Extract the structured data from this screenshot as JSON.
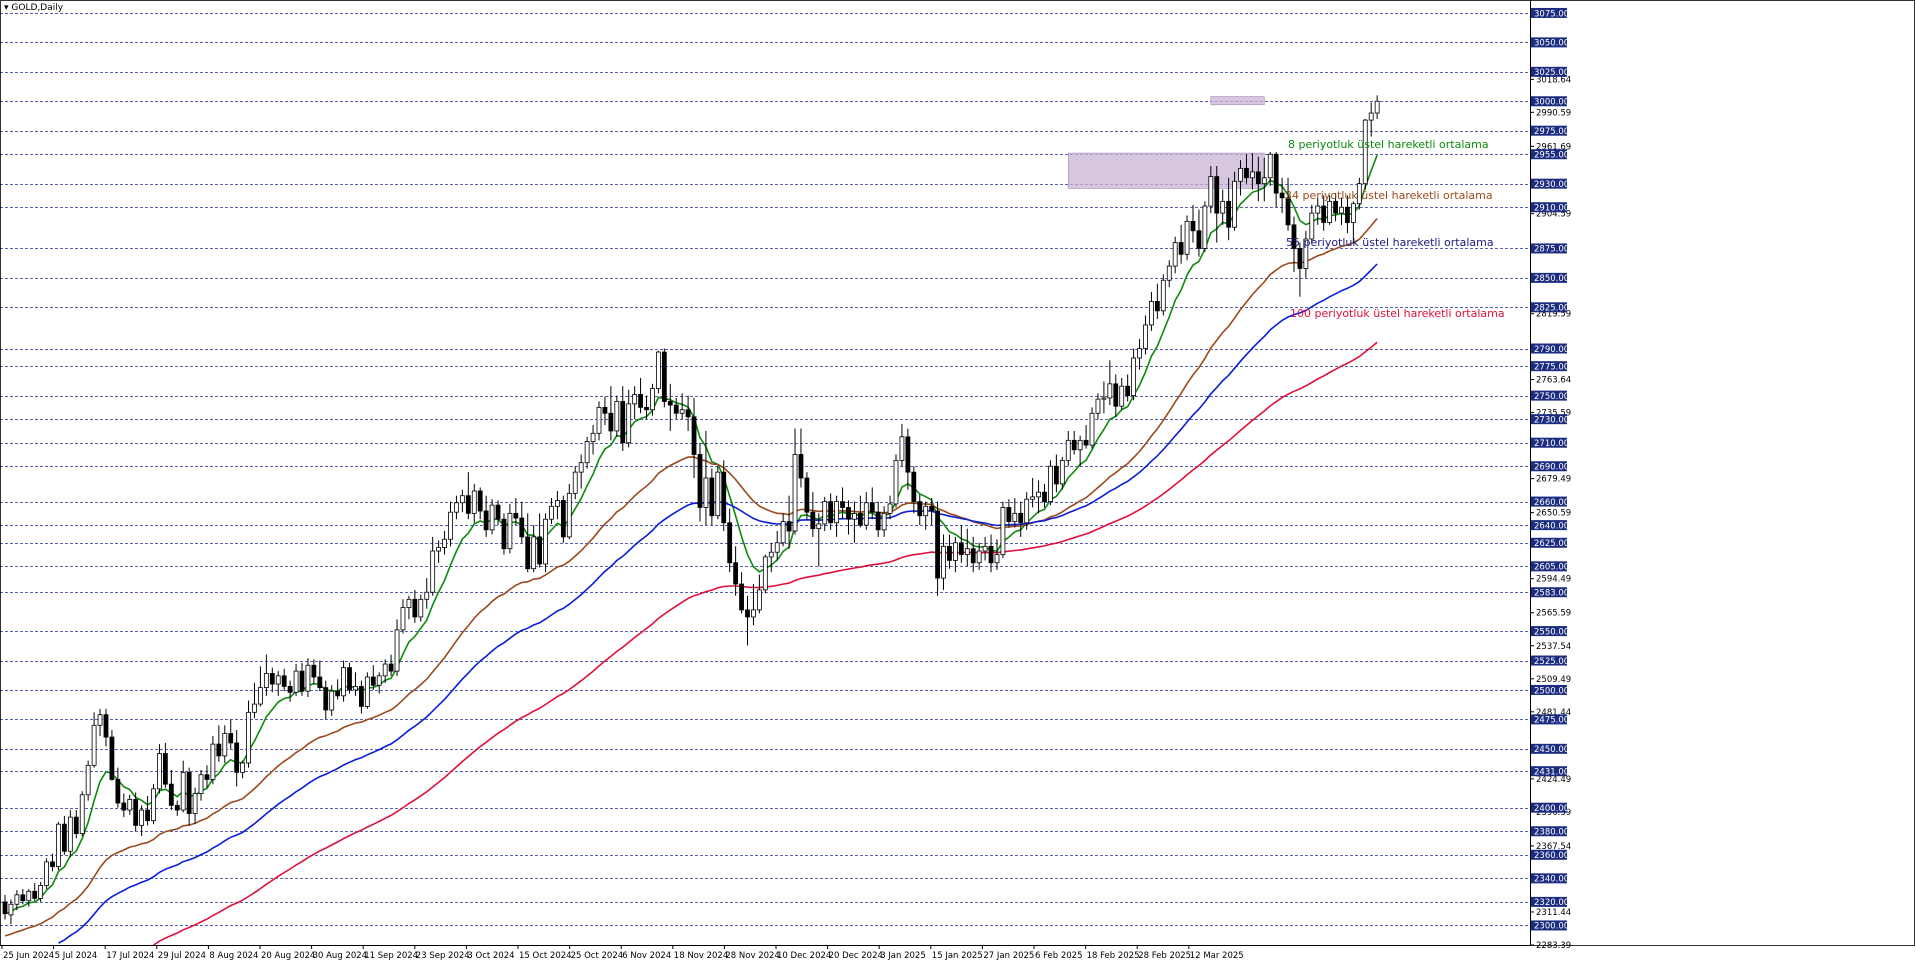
{
  "window": {
    "title": "GOLD,Daily"
  },
  "colors": {
    "background": "#ffffff",
    "grid": "#1f2f8f",
    "candle_up": "#ffffff",
    "candle_down": "#000000",
    "candle_border": "#000000",
    "ema8": "#0b8a0b",
    "ema34": "#9a4a1c",
    "ema55": "#0b1ed6",
    "ema100": "#e0103c",
    "zone": "#c9b3d6",
    "price_box_bg": "#1c2c80",
    "price_box_text": "#ffffff",
    "axis_text": "#000000"
  },
  "annotations": {
    "ema8": "8 periyotluk üstel hareketli ortalama",
    "ema34": "34 periyotluk üstel hareketli ortalama",
    "ema55": "55 periyotluk üstel hareketli ortalama",
    "ema100": "100 periyotluk üstel hareketli ortalama"
  },
  "chart_data": {
    "type": "candlestick",
    "title": "GOLD,Daily",
    "ylim": [
      2283.39,
      3086
    ],
    "x_tick_labels": [
      "25 Jun 2024",
      "5 Jul 2024",
      "17 Jul 2024",
      "29 Jul 2024",
      "8 Aug 2024",
      "20 Aug 2024",
      "30 Aug 2024",
      "11 Sep 2024",
      "23 Sep 2024",
      "3 Oct 2024",
      "15 Oct 2024",
      "25 Oct 2024",
      "6 Nov 2024",
      "18 Nov 2024",
      "28 Nov 2024",
      "10 Dec 2024",
      "20 Dec 2024",
      "3 Jan 2025",
      "15 Jan 2025",
      "27 Jan 2025",
      "6 Feb 2025",
      "18 Feb 2025",
      "28 Feb 2025",
      "12 Mar 2025"
    ],
    "price_levels": [
      3075,
      3050,
      3025,
      3000,
      2975,
      2955,
      2930,
      2910,
      2875,
      2850,
      2825,
      2790,
      2775,
      2750,
      2730,
      2710,
      2690,
      2660,
      2640,
      2625,
      2605,
      2583,
      2550,
      2525,
      2500,
      2475,
      2450,
      2431,
      2400,
      2380,
      2360,
      2340,
      2320,
      2300
    ],
    "extra_axis_labels": [
      3018.64,
      2990.59,
      2961.69,
      2904.59,
      2819.59,
      2763.64,
      2735.59,
      2679.49,
      2650.59,
      2594.49,
      2565.59,
      2537.54,
      2509.49,
      2481.44,
      2424.49,
      2396.39,
      2367.54,
      2311.44,
      2283.39
    ],
    "zones": [
      {
        "from_index": 179,
        "to_index": 212,
        "low": 2926,
        "high": 2956
      },
      {
        "from_index": 203,
        "to_index": 212,
        "low": 2997,
        "high": 3004
      }
    ],
    "candles": [
      [
        2320,
        2326,
        2305,
        2310
      ],
      [
        2309,
        2322,
        2301,
        2318
      ],
      [
        2318,
        2330,
        2313,
        2326
      ],
      [
        2326,
        2331,
        2318,
        2321
      ],
      [
        2321,
        2331,
        2316,
        2329
      ],
      [
        2329,
        2336,
        2321,
        2323
      ],
      [
        2323,
        2337,
        2320,
        2334
      ],
      [
        2334,
        2357,
        2331,
        2354
      ],
      [
        2354,
        2361,
        2346,
        2350
      ],
      [
        2350,
        2388,
        2347,
        2386
      ],
      [
        2386,
        2393,
        2360,
        2363
      ],
      [
        2363,
        2398,
        2358,
        2392
      ],
      [
        2392,
        2398,
        2374,
        2378
      ],
      [
        2378,
        2414,
        2376,
        2411
      ],
      [
        2411,
        2440,
        2406,
        2436
      ],
      [
        2436,
        2481,
        2434,
        2470
      ],
      [
        2470,
        2484,
        2461,
        2479
      ],
      [
        2479,
        2484,
        2452,
        2460
      ],
      [
        2460,
        2466,
        2423,
        2424
      ],
      [
        2424,
        2434,
        2400,
        2404
      ],
      [
        2404,
        2412,
        2392,
        2398
      ],
      [
        2398,
        2411,
        2394,
        2407
      ],
      [
        2407,
        2413,
        2380,
        2385
      ],
      [
        2385,
        2402,
        2376,
        2398
      ],
      [
        2398,
        2410,
        2385,
        2389
      ],
      [
        2389,
        2420,
        2386,
        2416
      ],
      [
        2416,
        2454,
        2412,
        2446
      ],
      [
        2446,
        2455,
        2417,
        2420
      ],
      [
        2420,
        2432,
        2398,
        2402
      ],
      [
        2402,
        2406,
        2393,
        2398
      ],
      [
        2398,
        2440,
        2396,
        2430
      ],
      [
        2430,
        2434,
        2385,
        2395
      ],
      [
        2395,
        2417,
        2386,
        2412
      ],
      [
        2412,
        2432,
        2406,
        2428
      ],
      [
        2428,
        2436,
        2417,
        2424
      ],
      [
        2424,
        2461,
        2420,
        2454
      ],
      [
        2454,
        2470,
        2439,
        2444
      ],
      [
        2444,
        2470,
        2438,
        2463
      ],
      [
        2463,
        2475,
        2450,
        2455
      ],
      [
        2455,
        2466,
        2418,
        2430
      ],
      [
        2430,
        2440,
        2425,
        2438
      ],
      [
        2438,
        2491,
        2434,
        2481
      ],
      [
        2481,
        2506,
        2476,
        2488
      ],
      [
        2488,
        2520,
        2486,
        2502
      ],
      [
        2502,
        2530,
        2495,
        2514
      ],
      [
        2514,
        2519,
        2498,
        2505
      ],
      [
        2505,
        2516,
        2495,
        2512
      ],
      [
        2512,
        2518,
        2499,
        2503
      ],
      [
        2503,
        2508,
        2490,
        2498
      ],
      [
        2498,
        2522,
        2495,
        2516
      ],
      [
        2516,
        2523,
        2495,
        2499
      ],
      [
        2499,
        2527,
        2494,
        2521
      ],
      [
        2521,
        2526,
        2505,
        2511
      ],
      [
        2511,
        2525,
        2499,
        2502
      ],
      [
        2502,
        2508,
        2475,
        2483
      ],
      [
        2483,
        2504,
        2478,
        2499
      ],
      [
        2499,
        2509,
        2492,
        2495
      ],
      [
        2495,
        2525,
        2490,
        2519
      ],
      [
        2519,
        2523,
        2497,
        2500
      ],
      [
        2500,
        2515,
        2495,
        2503
      ],
      [
        2503,
        2508,
        2480,
        2486
      ],
      [
        2486,
        2515,
        2484,
        2511
      ],
      [
        2511,
        2521,
        2500,
        2504
      ],
      [
        2504,
        2515,
        2497,
        2512
      ],
      [
        2512,
        2526,
        2506,
        2522
      ],
      [
        2522,
        2530,
        2512,
        2516
      ],
      [
        2516,
        2560,
        2512,
        2551
      ],
      [
        2551,
        2577,
        2548,
        2570
      ],
      [
        2570,
        2580,
        2560,
        2577
      ],
      [
        2577,
        2585,
        2557,
        2562
      ],
      [
        2562,
        2581,
        2558,
        2577
      ],
      [
        2577,
        2595,
        2569,
        2583
      ],
      [
        2583,
        2630,
        2580,
        2618
      ],
      [
        2618,
        2627,
        2608,
        2621
      ],
      [
        2621,
        2635,
        2615,
        2628
      ],
      [
        2628,
        2660,
        2622,
        2651
      ],
      [
        2651,
        2665,
        2645,
        2659
      ],
      [
        2659,
        2670,
        2651,
        2665
      ],
      [
        2665,
        2685,
        2645,
        2650
      ],
      [
        2650,
        2675,
        2642,
        2669
      ],
      [
        2669,
        2672,
        2645,
        2652
      ],
      [
        2652,
        2665,
        2630,
        2636
      ],
      [
        2636,
        2662,
        2632,
        2657
      ],
      [
        2657,
        2661,
        2640,
        2645
      ],
      [
        2645,
        2650,
        2615,
        2620
      ],
      [
        2620,
        2658,
        2616,
        2650
      ],
      [
        2650,
        2663,
        2640,
        2646
      ],
      [
        2646,
        2660,
        2625,
        2630
      ],
      [
        2630,
        2650,
        2600,
        2603
      ],
      [
        2603,
        2640,
        2600,
        2630
      ],
      [
        2630,
        2650,
        2604,
        2607
      ],
      [
        2607,
        2650,
        2600,
        2645
      ],
      [
        2645,
        2663,
        2641,
        2656
      ],
      [
        2656,
        2669,
        2645,
        2661
      ],
      [
        2661,
        2665,
        2625,
        2630
      ],
      [
        2630,
        2675,
        2628,
        2667
      ],
      [
        2667,
        2690,
        2662,
        2685
      ],
      [
        2685,
        2700,
        2671,
        2693
      ],
      [
        2693,
        2715,
        2688,
        2711
      ],
      [
        2711,
        2725,
        2700,
        2718
      ],
      [
        2718,
        2745,
        2712,
        2740
      ],
      [
        2740,
        2749,
        2725,
        2735
      ],
      [
        2735,
        2758,
        2712,
        2720
      ],
      [
        2720,
        2750,
        2715,
        2745
      ],
      [
        2745,
        2758,
        2703,
        2710
      ],
      [
        2710,
        2755,
        2706,
        2743
      ],
      [
        2743,
        2758,
        2730,
        2751
      ],
      [
        2751,
        2765,
        2735,
        2740
      ],
      [
        2740,
        2750,
        2730,
        2738
      ],
      [
        2738,
        2760,
        2733,
        2756
      ],
      [
        2756,
        2788,
        2752,
        2787
      ],
      [
        2787,
        2790,
        2740,
        2745
      ],
      [
        2745,
        2760,
        2720,
        2742
      ],
      [
        2742,
        2748,
        2730,
        2735
      ],
      [
        2735,
        2752,
        2730,
        2738
      ],
      [
        2738,
        2750,
        2720,
        2732
      ],
      [
        2732,
        2748,
        2680,
        2700
      ],
      [
        2700,
        2710,
        2643,
        2655
      ],
      [
        2655,
        2720,
        2640,
        2680
      ],
      [
        2680,
        2688,
        2640,
        2648
      ],
      [
        2648,
        2690,
        2645,
        2685
      ],
      [
        2685,
        2695,
        2635,
        2642
      ],
      [
        2642,
        2654,
        2600,
        2608
      ],
      [
        2608,
        2622,
        2580,
        2590
      ],
      [
        2590,
        2600,
        2565,
        2568
      ],
      [
        2568,
        2580,
        2538,
        2562
      ],
      [
        2562,
        2590,
        2555,
        2568
      ],
      [
        2568,
        2598,
        2565,
        2585
      ],
      [
        2585,
        2615,
        2582,
        2613
      ],
      [
        2613,
        2625,
        2600,
        2617
      ],
      [
        2617,
        2635,
        2610,
        2625
      ],
      [
        2625,
        2650,
        2622,
        2643
      ],
      [
        2643,
        2665,
        2620,
        2635
      ],
      [
        2635,
        2722,
        2632,
        2700
      ],
      [
        2700,
        2722,
        2672,
        2680
      ],
      [
        2680,
        2685,
        2645,
        2651
      ],
      [
        2651,
        2668,
        2630,
        2637
      ],
      [
        2637,
        2650,
        2605,
        2641
      ],
      [
        2641,
        2664,
        2635,
        2660
      ],
      [
        2660,
        2667,
        2636,
        2642
      ],
      [
        2642,
        2665,
        2630,
        2660
      ],
      [
        2660,
        2672,
        2645,
        2655
      ],
      [
        2655,
        2661,
        2632,
        2645
      ],
      [
        2645,
        2660,
        2625,
        2650
      ],
      [
        2650,
        2665,
        2638,
        2640
      ],
      [
        2640,
        2668,
        2636,
        2659
      ],
      [
        2659,
        2672,
        2645,
        2651
      ],
      [
        2651,
        2660,
        2630,
        2636
      ],
      [
        2636,
        2656,
        2630,
        2650
      ],
      [
        2650,
        2665,
        2645,
        2658
      ],
      [
        2658,
        2700,
        2655,
        2695
      ],
      [
        2695,
        2726,
        2690,
        2715
      ],
      [
        2715,
        2722,
        2670,
        2685
      ],
      [
        2685,
        2690,
        2650,
        2660
      ],
      [
        2660,
        2666,
        2640,
        2648
      ],
      [
        2648,
        2660,
        2636,
        2656
      ],
      [
        2656,
        2663,
        2640,
        2652
      ],
      [
        2652,
        2660,
        2580,
        2595
      ],
      [
        2595,
        2632,
        2585,
        2622
      ],
      [
        2622,
        2632,
        2603,
        2610
      ],
      [
        2610,
        2630,
        2600,
        2625
      ],
      [
        2625,
        2640,
        2608,
        2615
      ],
      [
        2615,
        2637,
        2605,
        2620
      ],
      [
        2620,
        2630,
        2600,
        2608
      ],
      [
        2608,
        2625,
        2602,
        2618
      ],
      [
        2618,
        2630,
        2610,
        2622
      ],
      [
        2622,
        2632,
        2600,
        2608
      ],
      [
        2608,
        2628,
        2602,
        2615
      ],
      [
        2615,
        2660,
        2612,
        2655
      ],
      [
        2655,
        2662,
        2638,
        2643
      ],
      [
        2643,
        2663,
        2638,
        2650
      ],
      [
        2650,
        2660,
        2630,
        2642
      ],
      [
        2642,
        2668,
        2636,
        2662
      ],
      [
        2662,
        2680,
        2655,
        2664
      ],
      [
        2664,
        2678,
        2650,
        2668
      ],
      [
        2668,
        2675,
        2655,
        2660
      ],
      [
        2660,
        2695,
        2657,
        2690
      ],
      [
        2690,
        2700,
        2668,
        2675
      ],
      [
        2675,
        2698,
        2670,
        2695
      ],
      [
        2695,
        2720,
        2690,
        2712
      ],
      [
        2712,
        2720,
        2700,
        2704
      ],
      [
        2704,
        2716,
        2690,
        2712
      ],
      [
        2712,
        2725,
        2705,
        2708
      ],
      [
        2708,
        2740,
        2705,
        2735
      ],
      [
        2735,
        2752,
        2730,
        2747
      ],
      [
        2747,
        2762,
        2735,
        2748
      ],
      [
        2748,
        2780,
        2742,
        2760
      ],
      [
        2760,
        2768,
        2732,
        2741
      ],
      [
        2741,
        2765,
        2738,
        2758
      ],
      [
        2758,
        2768,
        2745,
        2750
      ],
      [
        2750,
        2790,
        2746,
        2782
      ],
      [
        2782,
        2798,
        2772,
        2790
      ],
      [
        2790,
        2818,
        2785,
        2810
      ],
      [
        2810,
        2838,
        2805,
        2830
      ],
      [
        2830,
        2845,
        2815,
        2822
      ],
      [
        2822,
        2853,
        2818,
        2848
      ],
      [
        2848,
        2865,
        2842,
        2860
      ],
      [
        2860,
        2885,
        2854,
        2880
      ],
      [
        2880,
        2895,
        2862,
        2870
      ],
      [
        2870,
        2903,
        2865,
        2898
      ],
      [
        2898,
        2912,
        2880,
        2890
      ],
      [
        2890,
        2908,
        2868,
        2875
      ],
      [
        2875,
        2915,
        2872,
        2911
      ],
      [
        2911,
        2945,
        2905,
        2936
      ],
      [
        2936,
        2945,
        2880,
        2905
      ],
      [
        2905,
        2925,
        2895,
        2915
      ],
      [
        2915,
        2935,
        2882,
        2893
      ],
      [
        2893,
        2940,
        2890,
        2932
      ],
      [
        2932,
        2950,
        2920,
        2943
      ],
      [
        2943,
        2955,
        2930,
        2935
      ],
      [
        2935,
        2956,
        2925,
        2940
      ],
      [
        2940,
        2953,
        2915,
        2930
      ],
      [
        2930,
        2952,
        2915,
        2935
      ],
      [
        2935,
        2957,
        2928,
        2955
      ],
      [
        2955,
        2957,
        2910,
        2922
      ],
      [
        2922,
        2935,
        2905,
        2918
      ],
      [
        2918,
        2935,
        2890,
        2895
      ],
      [
        2895,
        2902,
        2855,
        2875
      ],
      [
        2875,
        2880,
        2834,
        2858
      ],
      [
        2858,
        2890,
        2850,
        2883
      ],
      [
        2883,
        2912,
        2880,
        2905
      ],
      [
        2905,
        2918,
        2895,
        2911
      ],
      [
        2911,
        2920,
        2890,
        2897
      ],
      [
        2897,
        2920,
        2895,
        2915
      ],
      [
        2915,
        2922,
        2898,
        2905
      ],
      [
        2905,
        2918,
        2895,
        2910
      ],
      [
        2910,
        2920,
        2888,
        2897
      ],
      [
        2897,
        2915,
        2880,
        2913
      ],
      [
        2913,
        2935,
        2908,
        2930
      ],
      [
        2930,
        2985,
        2925,
        2984
      ],
      [
        2984,
        2999,
        2970,
        2990
      ],
      [
        2990,
        3005,
        2985,
        3000
      ]
    ],
    "series": [
      {
        "name": "8 periyotluk üstel hareketli ortalama",
        "period": 8
      },
      {
        "name": "34 periyotluk üstel hareketli ortalama",
        "period": 34
      },
      {
        "name": "55 periyotluk üstel hareketli ortalama",
        "period": 55
      },
      {
        "name": "100 periyotluk üstel hareketli ortalama",
        "period": 100
      }
    ]
  }
}
